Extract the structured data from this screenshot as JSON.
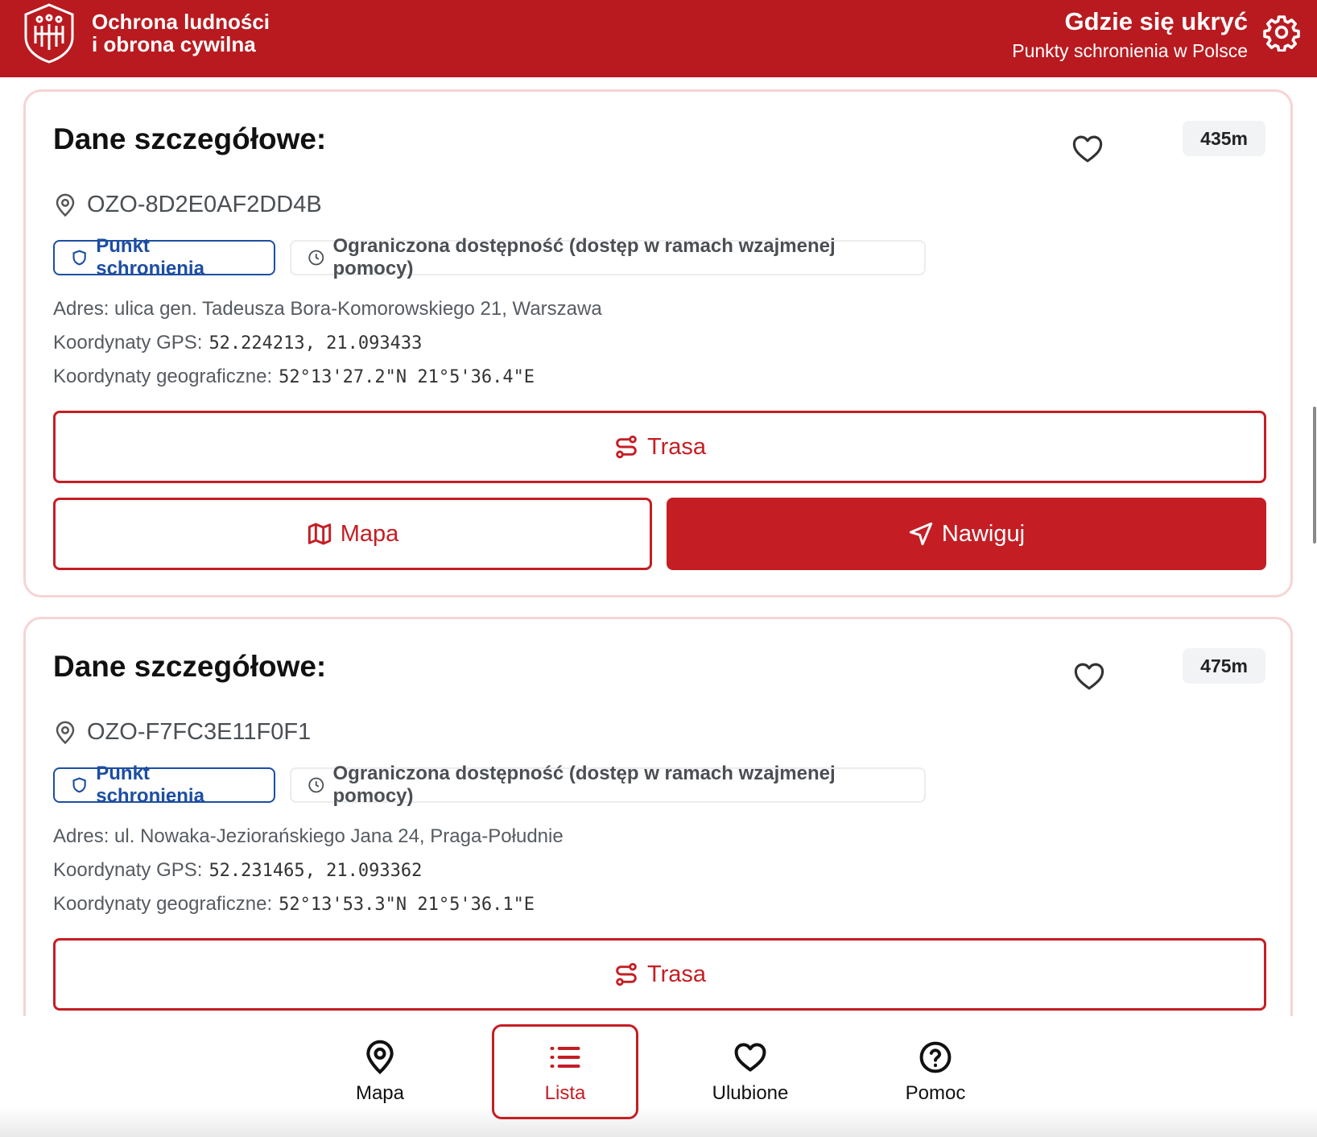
{
  "header": {
    "brand_line1": "Ochrona ludności",
    "brand_line2": "i obrona cywilna",
    "title": "Gdzie się ukryć",
    "subtitle": "Punkty schronienia w Polsce",
    "icons": {
      "logo": "civil-defence-logo",
      "settings": "gear-icon"
    }
  },
  "colors": {
    "brand": "#b81a1f",
    "accent": "#c41e24",
    "badge_blue": "#1d4ea1"
  },
  "shelters": [
    {
      "title": "Dane szczegółowe:",
      "distance": "435m",
      "id": "OZO-8D2E0AF2DD4B",
      "type_badge": "Punkt schronienia",
      "availability_badge": "Ograniczona dostępność (dostęp w ramach wzajmenej pomocy)",
      "address_label": "Adres:",
      "address": "ulica gen. Tadeusza Bora-Komorowskiego 21, Warszawa",
      "gps_label": "Koordynaty GPS:",
      "gps": "52.224213, 21.093433",
      "geo_label": "Koordynaty geograficzne:",
      "geo": "52°13'27.2\"N 21°5'36.4\"E",
      "route_label": "Trasa",
      "map_label": "Mapa",
      "navigate_label": "Nawiguj"
    },
    {
      "title": "Dane szczegółowe:",
      "distance": "475m",
      "id": "OZO-F7FC3E11F0F1",
      "type_badge": "Punkt schronienia",
      "availability_badge": "Ograniczona dostępność (dostęp w ramach wzajmenej pomocy)",
      "address_label": "Adres:",
      "address": "ul. Nowaka-Jeziorańskiego Jana 24, Praga-Południe",
      "gps_label": "Koordynaty GPS:",
      "gps": "52.231465, 21.093362",
      "geo_label": "Koordynaty geograficzne:",
      "geo": "52°13'53.3\"N 21°5'36.1\"E",
      "route_label": "Trasa"
    }
  ],
  "bottom_nav": [
    {
      "label": "Mapa",
      "icon": "map-pin-icon",
      "active": false
    },
    {
      "label": "Lista",
      "icon": "list-icon",
      "active": true
    },
    {
      "label": "Ulubione",
      "icon": "heart-icon",
      "active": false
    },
    {
      "label": "Pomoc",
      "icon": "help-circle-icon",
      "active": false
    }
  ]
}
